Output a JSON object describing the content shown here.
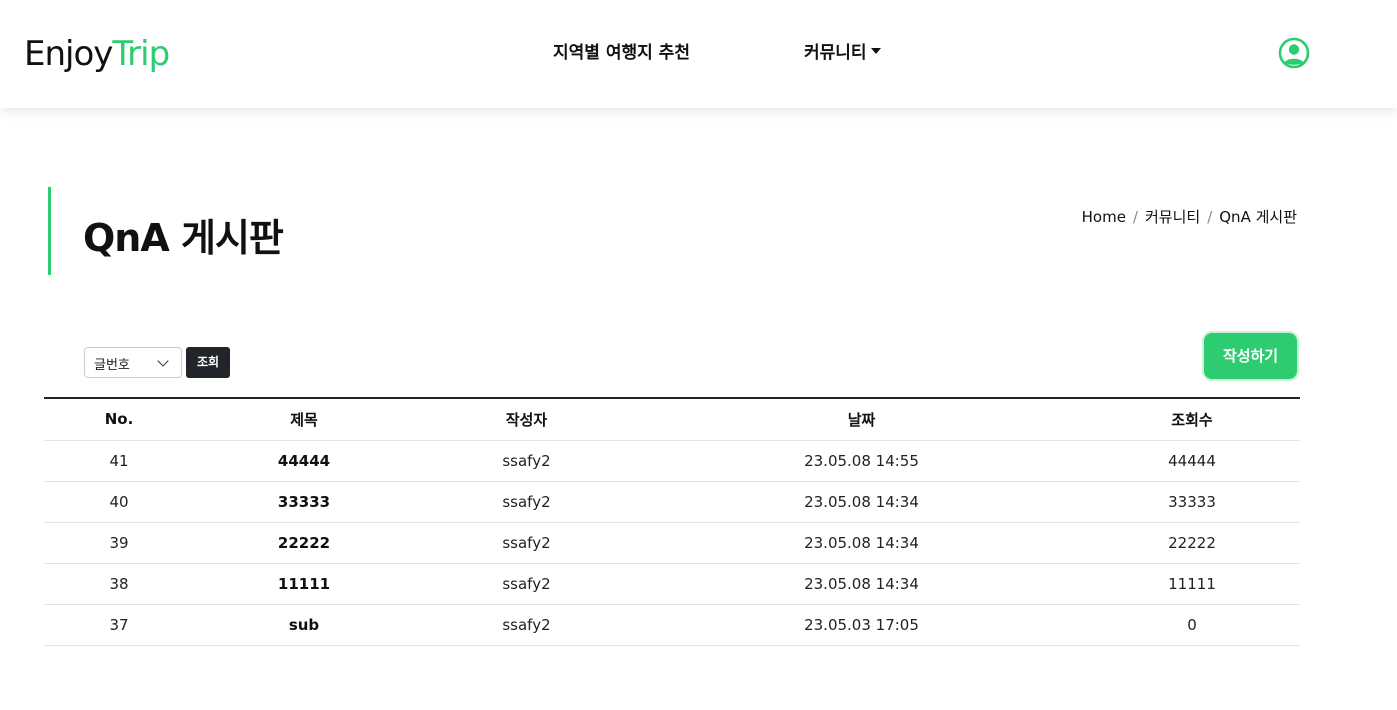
{
  "brand": {
    "part1": "Enjoy",
    "part2": "Trip",
    "accent_color": "#2ecc71"
  },
  "nav": {
    "items": [
      {
        "label": "지역별 여행지 추천"
      },
      {
        "label": "커뮤니티"
      }
    ],
    "user_icon": "user-circle-icon"
  },
  "page": {
    "title": "QnA 게시판",
    "breadcrumb": [
      "Home",
      "커뮤니티",
      "QnA 게시판"
    ]
  },
  "controls": {
    "search_field": "글번호",
    "search_button": "조회",
    "write_button": "작성하기"
  },
  "table": {
    "headers": [
      "No.",
      "제목",
      "작성자",
      "날짜",
      "조회수"
    ],
    "rows": [
      {
        "no": "41",
        "title": "44444",
        "author": "ssafy2",
        "date": "23.05.08 14:55",
        "views": "44444"
      },
      {
        "no": "40",
        "title": "33333",
        "author": "ssafy2",
        "date": "23.05.08 14:34",
        "views": "33333"
      },
      {
        "no": "39",
        "title": "22222",
        "author": "ssafy2",
        "date": "23.05.08 14:34",
        "views": "22222"
      },
      {
        "no": "38",
        "title": "11111",
        "author": "ssafy2",
        "date": "23.05.08 14:34",
        "views": "11111"
      },
      {
        "no": "37",
        "title": "sub",
        "author": "ssafy2",
        "date": "23.05.03 17:05",
        "views": "0"
      }
    ]
  }
}
